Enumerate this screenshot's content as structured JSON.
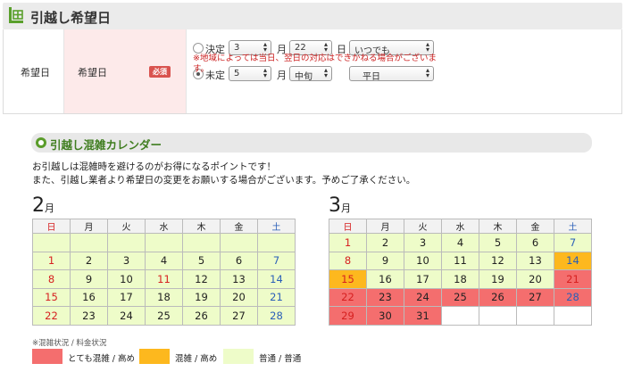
{
  "header": {
    "title": "引越し希望日",
    "icon": "calendar-truck-icon"
  },
  "form": {
    "label": "希望日",
    "sub_label": "希望日",
    "required_badge": "必須",
    "fixed": {
      "radio_label": "決定",
      "selected": false,
      "month_value": "3",
      "month_unit": "月",
      "day_value": "22",
      "day_unit": "日",
      "weekday_value": "いつでも"
    },
    "tentative": {
      "radio_label": "未定",
      "selected": true,
      "month_value": "5",
      "month_unit": "月",
      "period_value": "中旬",
      "weekday_value": "平日"
    },
    "note": "※地域によっては当日、翌日の対応はできかねる場合がございます。"
  },
  "calendar_section": {
    "title": "引越し混雑カレンダー",
    "intro_line1": "お引越しは混雑時を避けるのがお得になるポイントです！",
    "intro_line2": "また、引越し業者より希望日の変更をお願いする場合がございます。予めご了承ください。",
    "weekdays": [
      "日",
      "月",
      "火",
      "水",
      "木",
      "金",
      "土"
    ],
    "months": [
      {
        "number": "2",
        "unit": "月",
        "weeks": [
          [
            {
              "d": "",
              "s": "normal"
            },
            {
              "d": "",
              "s": "normal"
            },
            {
              "d": "",
              "s": "normal"
            },
            {
              "d": "",
              "s": "normal"
            },
            {
              "d": "",
              "s": "normal"
            },
            {
              "d": "",
              "s": "normal"
            },
            {
              "d": "",
              "s": "normal"
            }
          ],
          [
            {
              "d": "1",
              "s": "normal"
            },
            {
              "d": "2",
              "s": "normal"
            },
            {
              "d": "3",
              "s": "normal"
            },
            {
              "d": "4",
              "s": "normal"
            },
            {
              "d": "5",
              "s": "normal"
            },
            {
              "d": "6",
              "s": "normal"
            },
            {
              "d": "7",
              "s": "normal"
            }
          ],
          [
            {
              "d": "8",
              "s": "normal"
            },
            {
              "d": "9",
              "s": "normal"
            },
            {
              "d": "10",
              "s": "normal"
            },
            {
              "d": "11",
              "s": "normal",
              "holiday": true
            },
            {
              "d": "12",
              "s": "normal"
            },
            {
              "d": "13",
              "s": "normal"
            },
            {
              "d": "14",
              "s": "normal"
            }
          ],
          [
            {
              "d": "15",
              "s": "normal"
            },
            {
              "d": "16",
              "s": "normal"
            },
            {
              "d": "17",
              "s": "normal"
            },
            {
              "d": "18",
              "s": "normal"
            },
            {
              "d": "19",
              "s": "normal"
            },
            {
              "d": "20",
              "s": "normal"
            },
            {
              "d": "21",
              "s": "normal"
            }
          ],
          [
            {
              "d": "22",
              "s": "normal"
            },
            {
              "d": "23",
              "s": "normal"
            },
            {
              "d": "24",
              "s": "normal"
            },
            {
              "d": "25",
              "s": "normal"
            },
            {
              "d": "26",
              "s": "normal"
            },
            {
              "d": "27",
              "s": "normal"
            },
            {
              "d": "28",
              "s": "normal"
            }
          ]
        ]
      },
      {
        "number": "3",
        "unit": "月",
        "weeks": [
          [
            {
              "d": "1",
              "s": "normal"
            },
            {
              "d": "2",
              "s": "normal"
            },
            {
              "d": "3",
              "s": "normal"
            },
            {
              "d": "4",
              "s": "normal"
            },
            {
              "d": "5",
              "s": "normal"
            },
            {
              "d": "6",
              "s": "normal"
            },
            {
              "d": "7",
              "s": "normal"
            }
          ],
          [
            {
              "d": "8",
              "s": "normal"
            },
            {
              "d": "9",
              "s": "normal"
            },
            {
              "d": "10",
              "s": "normal"
            },
            {
              "d": "11",
              "s": "normal"
            },
            {
              "d": "12",
              "s": "normal"
            },
            {
              "d": "13",
              "s": "normal"
            },
            {
              "d": "14",
              "s": "semi"
            }
          ],
          [
            {
              "d": "15",
              "s": "semi"
            },
            {
              "d": "16",
              "s": "normal"
            },
            {
              "d": "17",
              "s": "normal"
            },
            {
              "d": "18",
              "s": "normal"
            },
            {
              "d": "19",
              "s": "normal"
            },
            {
              "d": "20",
              "s": "normal"
            },
            {
              "d": "21",
              "s": "busy",
              "holiday": true
            }
          ],
          [
            {
              "d": "22",
              "s": "busy"
            },
            {
              "d": "23",
              "s": "busy"
            },
            {
              "d": "24",
              "s": "busy"
            },
            {
              "d": "25",
              "s": "busy"
            },
            {
              "d": "26",
              "s": "busy"
            },
            {
              "d": "27",
              "s": "busy"
            },
            {
              "d": "28",
              "s": "busy"
            }
          ],
          [
            {
              "d": "29",
              "s": "busy"
            },
            {
              "d": "30",
              "s": "busy"
            },
            {
              "d": "31",
              "s": "busy"
            },
            {
              "d": "",
              "s": "blank"
            },
            {
              "d": "",
              "s": "blank"
            },
            {
              "d": "",
              "s": "blank"
            },
            {
              "d": "",
              "s": "blank"
            }
          ]
        ]
      }
    ],
    "legend_title": "※混雑状況 / 料金状況",
    "legend": [
      {
        "key": "busy",
        "label": "とても混雑 / 高め",
        "color": "#f46e6e"
      },
      {
        "key": "semi",
        "label": "混雑 / 高め",
        "color": "#fdb81e"
      },
      {
        "key": "normal",
        "label": "普通 / 普通",
        "color": "#eefcc9"
      }
    ]
  }
}
